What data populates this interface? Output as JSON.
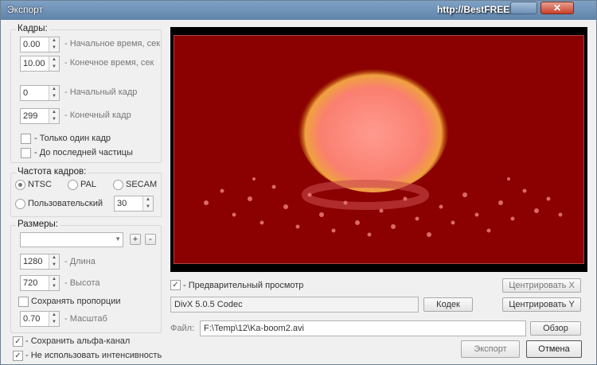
{
  "window": {
    "title": "Экспорт",
    "watermark": "http://BestFREE.ru",
    "close_icon": "close-icon"
  },
  "frames": {
    "title": "Кадры:",
    "start_time": {
      "value": "0.00",
      "label": "- Начальное время, сек"
    },
    "end_time": {
      "value": "10.00",
      "label": "- Конечное время, сек"
    },
    "start_frame": {
      "value": "0",
      "label": "- Начальный кадр"
    },
    "end_frame": {
      "value": "299",
      "label": "- Конечный кадр"
    },
    "single_frame": {
      "label": "- Только один кадр",
      "checked": false
    },
    "last_particle": {
      "label": "- До последней частицы",
      "checked": false
    }
  },
  "fps": {
    "title": "Частота кадров:",
    "ntsc": {
      "label": "NTSC",
      "selected": true
    },
    "pal": {
      "label": "PAL",
      "selected": false
    },
    "secam": {
      "label": "SECAM",
      "selected": false
    },
    "custom": {
      "label": "Пользовательский",
      "selected": false,
      "value": "30"
    }
  },
  "size": {
    "title": "Размеры:",
    "preset_value": "",
    "add": "+",
    "remove": "-",
    "length": {
      "value": "1280",
      "label": "- Длина"
    },
    "height": {
      "value": "720",
      "label": "- Высота"
    },
    "keep_ratio": {
      "label": "Сохранять пропорции",
      "checked": false
    },
    "scale": {
      "value": "0.70",
      "label": "- Масштаб"
    }
  },
  "options": {
    "alpha": {
      "label": "- Сохранить альфа-канал",
      "checked": true
    },
    "no_intensity": {
      "label": "- Не использовать интенсивность",
      "checked": true
    }
  },
  "preview": {
    "enabled": {
      "label": "- Предварительный просмотр",
      "checked": true
    },
    "center_x": "Центрировать X",
    "center_y": "Центрировать Y",
    "background_color": "#8b0000"
  },
  "codec": {
    "value": "DivX 5.0.5 Codec",
    "button": "Кодек"
  },
  "file": {
    "label": "Файл:",
    "value": "F:\\Temp\\12\\Ka-boom2.avi",
    "browse": "Обзор"
  },
  "actions": {
    "export": "Экспорт",
    "cancel": "Отмена"
  }
}
